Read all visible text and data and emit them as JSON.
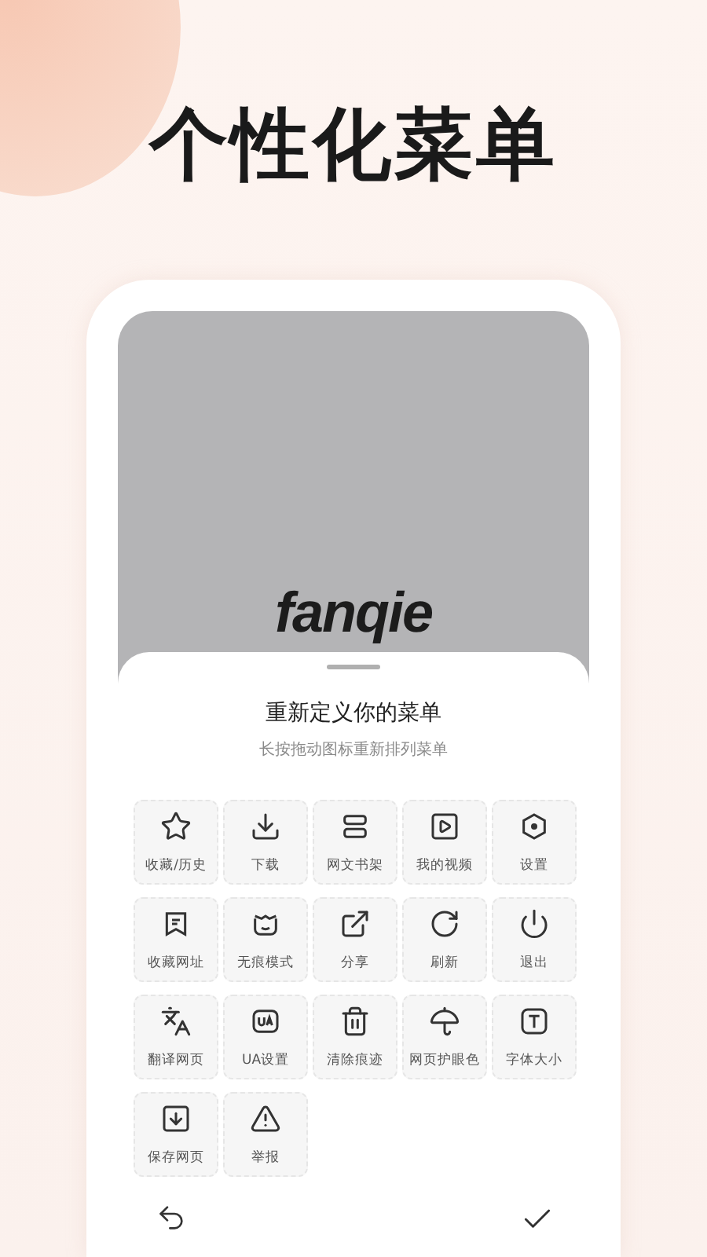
{
  "headline": "个性化菜单",
  "app_logo": "fanqie",
  "sheet": {
    "title": "重新定义你的菜单",
    "subtitle": "长按拖动图标重新排列菜单",
    "items": [
      {
        "label": "收藏/历史"
      },
      {
        "label": "下载"
      },
      {
        "label": "网文书架"
      },
      {
        "label": "我的视频"
      },
      {
        "label": "设置"
      },
      {
        "label": "收藏网址"
      },
      {
        "label": "无痕模式"
      },
      {
        "label": "分享"
      },
      {
        "label": "刷新"
      },
      {
        "label": "退出"
      },
      {
        "label": "翻译网页"
      },
      {
        "label": "UA设置"
      },
      {
        "label": "清除痕迹"
      },
      {
        "label": "网页护眼色"
      },
      {
        "label": "字体大小"
      },
      {
        "label": "保存网页"
      },
      {
        "label": "举报"
      }
    ]
  }
}
